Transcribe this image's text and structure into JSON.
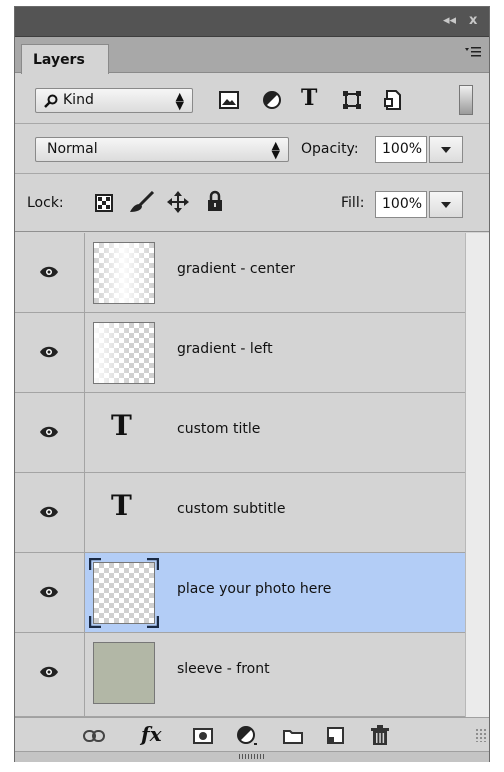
{
  "panel": {
    "tab_label": "Layers",
    "titlebar": {
      "collapse_icon": "double-chevron-left-icon",
      "close_label": "x"
    }
  },
  "filter": {
    "kind_label": "Kind",
    "icons": [
      "search-icon",
      "image-filter-icon",
      "adjustment-filter-icon",
      "type-filter-icon",
      "shape-filter-icon",
      "smart-object-filter-icon",
      "filter-toggle-switch"
    ]
  },
  "blend": {
    "mode": "Normal",
    "opacity_label": "Opacity:",
    "opacity_value": "100%"
  },
  "lock": {
    "label": "Lock:",
    "icons": [
      "lock-transparent-icon",
      "lock-image-pixels-icon",
      "lock-position-icon",
      "lock-all-icon"
    ],
    "fill_label": "Fill:",
    "fill_value": "100%"
  },
  "layers": [
    {
      "name": "gradient - center",
      "kind": "pixel",
      "visible": true,
      "selected": false
    },
    {
      "name": "gradient - left",
      "kind": "pixel",
      "visible": true,
      "selected": false
    },
    {
      "name": "custom title",
      "kind": "type",
      "visible": true,
      "selected": false
    },
    {
      "name": "custom subtitle",
      "kind": "type",
      "visible": true,
      "selected": false
    },
    {
      "name": "place your photo here",
      "kind": "pixel",
      "visible": true,
      "selected": true
    },
    {
      "name": "sleeve - front",
      "kind": "fill",
      "visible": true,
      "selected": false
    }
  ],
  "type_glyph": "T",
  "colors": {
    "selected_row": "#b3cdf6",
    "panel_bg": "#d4d4d4",
    "sleeve_fill": "#b2b7a6"
  },
  "footer": {
    "icons": [
      "link-layers-icon",
      "fx-icon",
      "layer-mask-icon",
      "adjustment-layer-icon",
      "group-folder-icon",
      "new-layer-icon",
      "trash-icon"
    ]
  }
}
